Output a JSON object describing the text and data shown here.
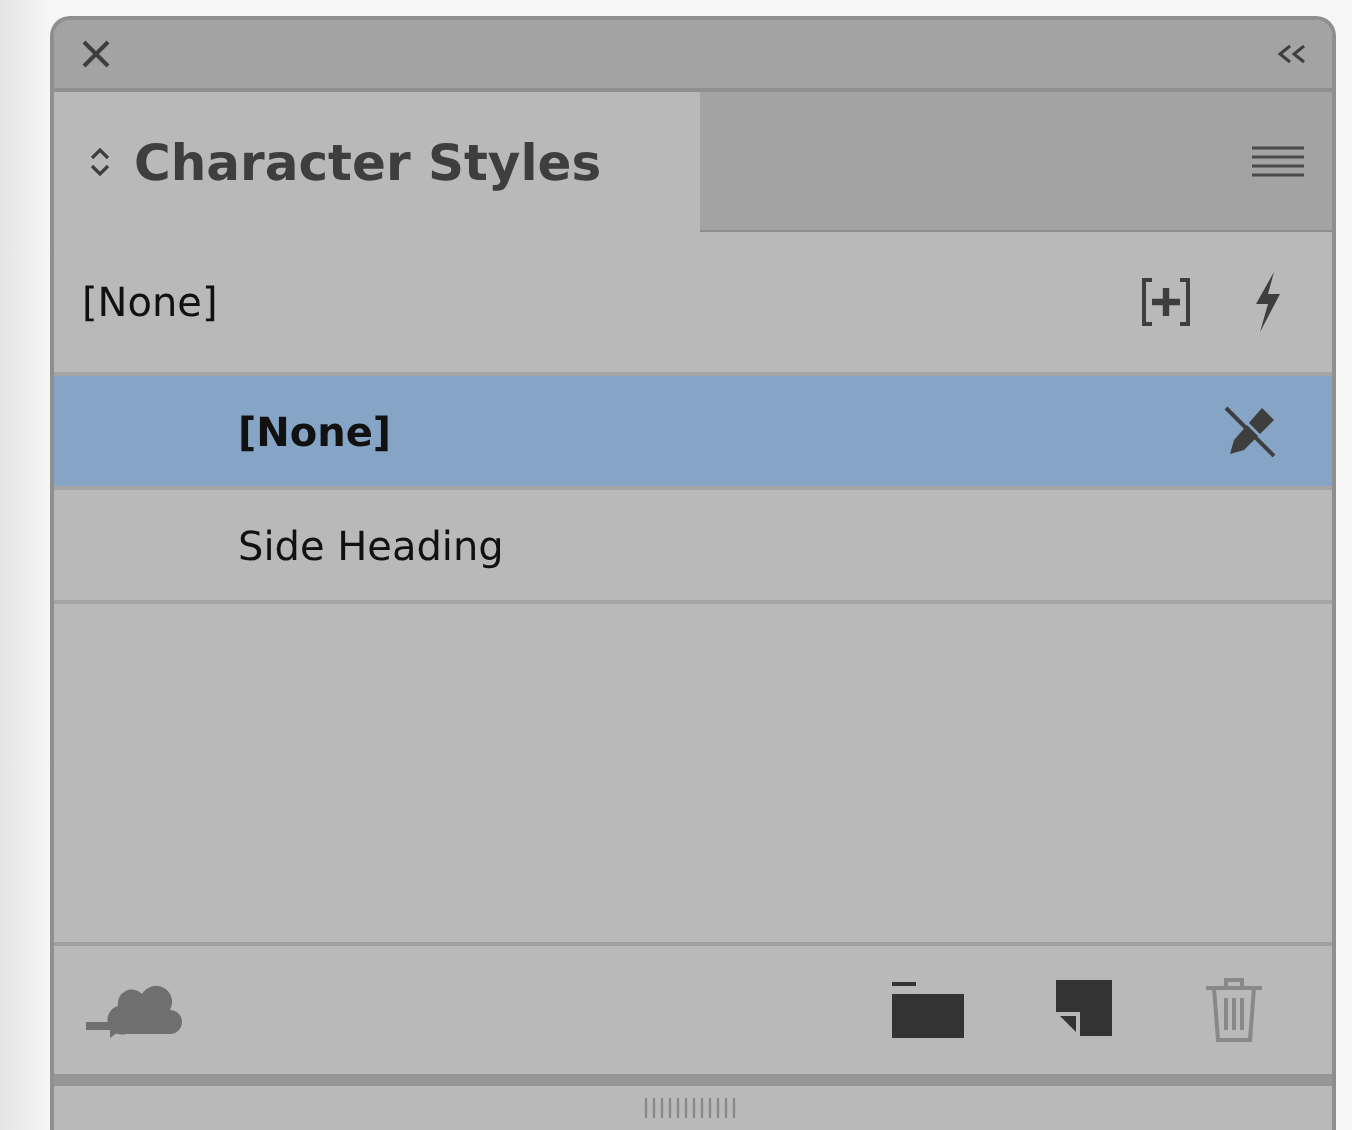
{
  "panel": {
    "tab": {
      "label": "Character Styles",
      "selected": true
    },
    "current_style": "[None]"
  },
  "styles": [
    {
      "name": "[None]",
      "selected": true,
      "locked": true
    },
    {
      "name": "Side Heading",
      "selected": false,
      "locked": false
    }
  ]
}
